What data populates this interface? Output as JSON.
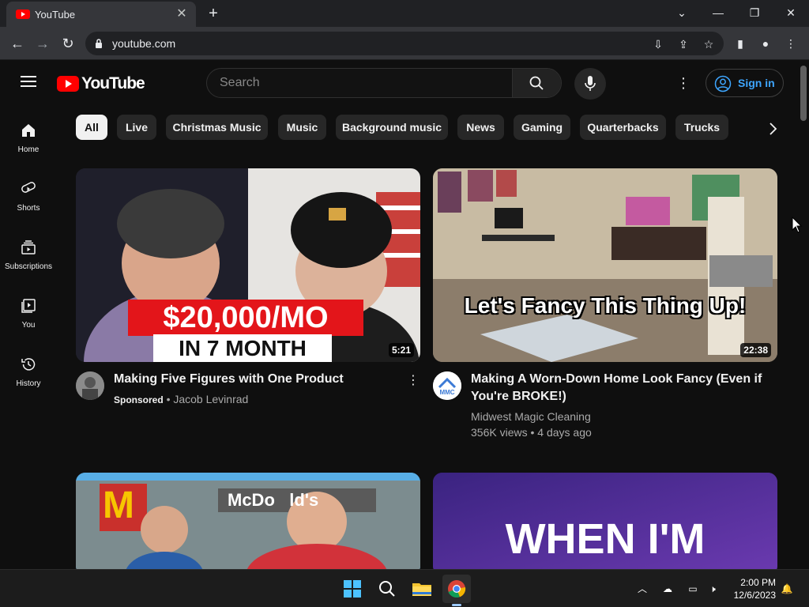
{
  "browser": {
    "tab_title": "YouTube",
    "url": "youtube.com"
  },
  "youtube": {
    "logo_text": "YouTube",
    "search_placeholder": "Search",
    "signin_label": "Sign in",
    "sidebar": [
      {
        "label": "Home",
        "icon": "home-icon"
      },
      {
        "label": "Shorts",
        "icon": "shorts-icon"
      },
      {
        "label": "Subscriptions",
        "icon": "subscriptions-icon"
      },
      {
        "label": "You",
        "icon": "you-icon"
      },
      {
        "label": "History",
        "icon": "history-icon"
      }
    ],
    "chips": [
      "All",
      "Live",
      "Christmas Music",
      "Music",
      "Background music",
      "News",
      "Gaming",
      "Quarterbacks",
      "Trucks"
    ],
    "videos": [
      {
        "title": "Making Five Figures with One Product",
        "badge": "Sponsored",
        "channel": "Jacob Levinrad",
        "duration": "5:21",
        "overlay_line1": "$20,000/MO",
        "overlay_line2": "IN 7 MONTH"
      },
      {
        "title_line1": "Making A Worn-Down Home Look Fancy (Even if",
        "title_line2": "You're BROKE!)",
        "channel": "Midwest Magic Cleaning",
        "meta": "356K views • 4 days ago",
        "duration": "22:38",
        "overlay": "Let's Fancy This Thing Up!",
        "avatar_text": "MMC"
      },
      {
        "overlay": "McDo   ld's",
        "logo": "M"
      },
      {
        "overlay": "WHEN I'M"
      }
    ]
  },
  "taskbar": {
    "time": "2:00 PM",
    "date": "12/6/2023"
  }
}
